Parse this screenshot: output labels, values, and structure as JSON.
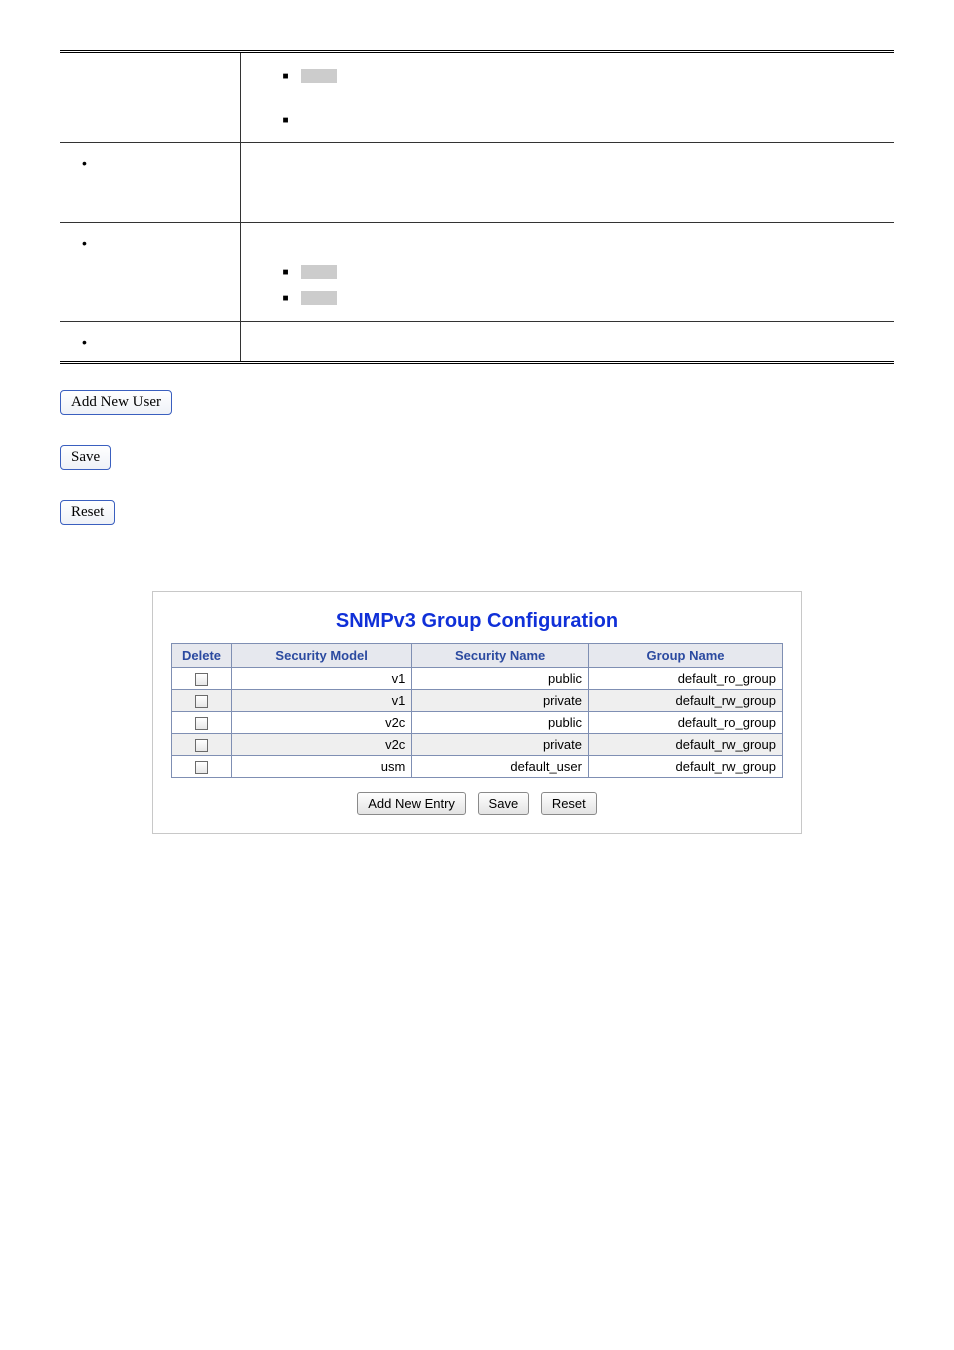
{
  "buttons": {
    "add_new_user": "Add New User",
    "save": "Save",
    "reset": "Reset",
    "add_new_entry": "Add New Entry"
  },
  "panel": {
    "title": "SNMPv3 Group Configuration",
    "headers": {
      "delete": "Delete",
      "security_model": "Security Model",
      "security_name": "Security Name",
      "group_name": "Group Name"
    },
    "rows": [
      {
        "model": "v1",
        "name": "public",
        "group": "default_ro_group"
      },
      {
        "model": "v1",
        "name": "private",
        "group": "default_rw_group"
      },
      {
        "model": "v2c",
        "name": "public",
        "group": "default_ro_group"
      },
      {
        "model": "v2c",
        "name": "private",
        "group": "default_rw_group"
      },
      {
        "model": "usm",
        "name": "default_user",
        "group": "default_rw_group"
      }
    ]
  }
}
